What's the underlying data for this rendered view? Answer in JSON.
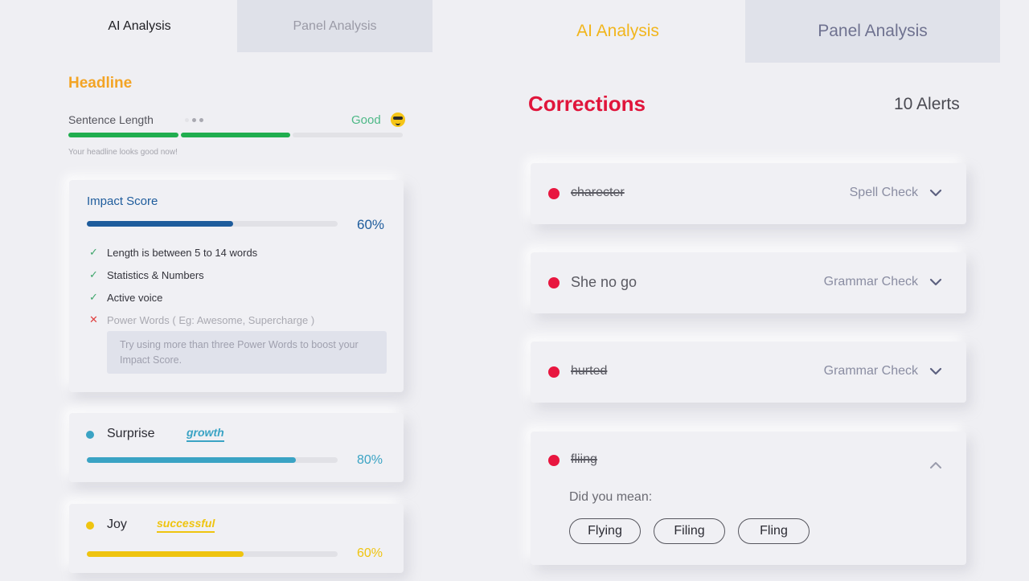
{
  "left_panel": {
    "tabs": [
      {
        "label": "AI Analysis",
        "active": true
      },
      {
        "label": "Panel Analysis",
        "active": false
      }
    ],
    "headline": {
      "title": "Headline",
      "sentence_length": {
        "label": "Sentence Length",
        "status": "Good",
        "status_icon": "sunglasses-emoji-icon",
        "segments_filled": 2,
        "segments_total": 3,
        "hint": "Your headline looks good now!"
      }
    },
    "impact_score": {
      "title": "Impact Score",
      "percent": 60,
      "percent_label": "60%",
      "color": "#1e5c9c",
      "checks": [
        {
          "label": "Length is between 5 to 14 words",
          "passed": true,
          "icon": "check-icon"
        },
        {
          "label": "Statistics & Numbers",
          "passed": true,
          "icon": "check-icon"
        },
        {
          "label": "Active voice",
          "passed": true,
          "icon": "check-icon"
        },
        {
          "label": "Power Words ( Eg: Awesome, Supercharge )",
          "passed": false,
          "icon": "cross-icon"
        }
      ],
      "tip": "Try using more than three Power Words to boost your Impact Score."
    },
    "emotions": [
      {
        "name": "Surprise",
        "word": "growth",
        "percent": 80,
        "percent_label": "80%",
        "color": "#3aa3c4"
      },
      {
        "name": "Joy",
        "word": "successful",
        "percent": 60,
        "percent_label": "60%",
        "color": "#efc40f"
      }
    ]
  },
  "right_panel": {
    "tabs": [
      {
        "label": "AI Analysis",
        "active": true
      },
      {
        "label": "Panel Analysis",
        "active": false
      }
    ],
    "title": "Corrections",
    "alerts_count": "10 Alerts",
    "accent": "#e0153b",
    "corrections": [
      {
        "word": "charecter",
        "strike": true,
        "type": "Spell Check",
        "expanded": false
      },
      {
        "word": "She no go",
        "strike": false,
        "type": "Grammar Check",
        "expanded": false
      },
      {
        "word": "hurted",
        "strike": true,
        "type": "Grammar Check",
        "expanded": false
      },
      {
        "word": "fliing",
        "strike": true,
        "type": "",
        "expanded": true,
        "prompt": "Did you mean:",
        "suggestions": [
          "Flying",
          "Filing",
          "Fling"
        ]
      }
    ]
  }
}
